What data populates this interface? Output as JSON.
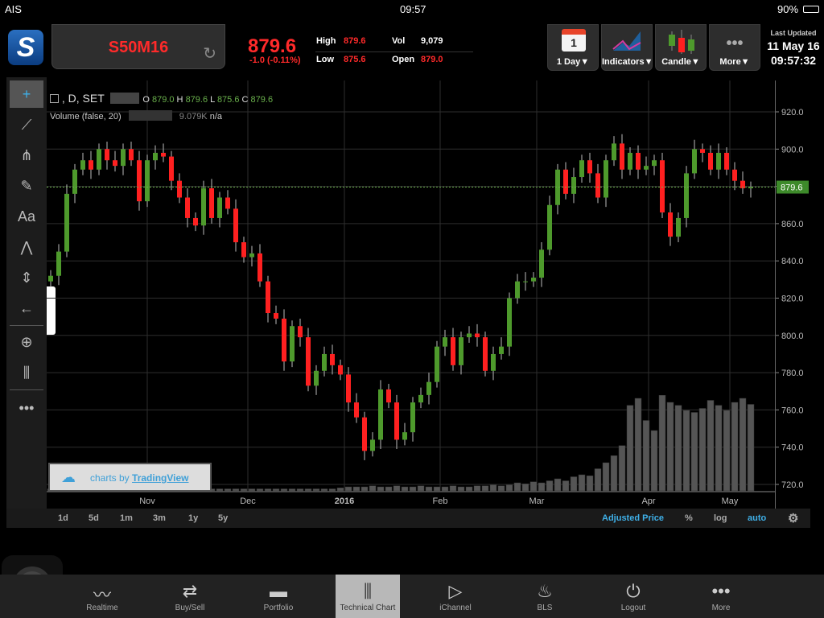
{
  "status": {
    "carrier": "AIS",
    "time": "09:57",
    "battery": "90%"
  },
  "header": {
    "symbol": "S50M16",
    "last": "879.6",
    "change": "-1.0 (-0.11%)",
    "high_label": "High",
    "high": "879.6",
    "low_label": "Low",
    "low": "875.6",
    "vol_label": "Vol",
    "vol": "9,079",
    "open_label": "Open",
    "open": "879.0"
  },
  "toolbar": {
    "period_day": "1",
    "period": "1 Day▼",
    "indicators": "Indicators▼",
    "candle": "Candle▼",
    "more": "More▼",
    "updated_label": "Last Updated",
    "updated_date": "11 May 16",
    "updated_time": "09:57:32"
  },
  "legend": {
    "title": ", D, SET",
    "o_label": "O",
    "o": "879.0",
    "h_label": "H",
    "h": "879.6",
    "l_label": "L",
    "l": "875.6",
    "c_label": "C",
    "c": "879.6",
    "volume": "Volume (false, 20)",
    "volume_val": "9.079K",
    "volume_na": "n/a"
  },
  "watermark": {
    "prefix": "charts by",
    "brand": "TradingView"
  },
  "ranges": [
    "1d",
    "5d",
    "1m",
    "3m",
    "1y",
    "5y"
  ],
  "options": {
    "adjusted": "Adjusted Price",
    "pct": "%",
    "log": "log",
    "auto": "auto"
  },
  "tabs": [
    "Realtime",
    "Buy/Sell",
    "Portfolio",
    "Technical Chart",
    "iChannel",
    "BLS",
    "Logout",
    "More"
  ],
  "colors": {
    "up": "#4e9a2c",
    "down": "#ff2020",
    "accent": "#3fb0e8"
  },
  "chart_data": {
    "type": "candlestick",
    "ylim": [
      712,
      928
    ],
    "yticks": [
      "920.0",
      "900.0",
      "880.0",
      "860.0",
      "840.0",
      "820.0",
      "800.0",
      "780.0",
      "760.0",
      "740.0",
      "720.0"
    ],
    "xticks": [
      {
        "label": "Nov",
        "index": 12
      },
      {
        "label": "Dec",
        "index": 24.5
      },
      {
        "label": "2016",
        "index": 36.5
      },
      {
        "label": "Feb",
        "index": 48.4
      },
      {
        "label": "Mar",
        "index": 60.4
      },
      {
        "label": "Apr",
        "index": 74.3
      },
      {
        "label": "May",
        "index": 84.4
      }
    ],
    "last_price": "879.6",
    "close": [
      832,
      845,
      876,
      889,
      894,
      889,
      900,
      894,
      891,
      900,
      894,
      872,
      894,
      898,
      896,
      883,
      874,
      863,
      859,
      879,
      863,
      874,
      868,
      850,
      842,
      844,
      829,
      812,
      809,
      786,
      805,
      799,
      773,
      781,
      790,
      784,
      779,
      764,
      756,
      738,
      744,
      771,
      764,
      744,
      748,
      764,
      768,
      775,
      794,
      799,
      784,
      799,
      801,
      799,
      781,
      790,
      794,
      820,
      829,
      829,
      831,
      846,
      870,
      889,
      876,
      885,
      894,
      887,
      874,
      894,
      903,
      889,
      898,
      889,
      891,
      894,
      866,
      853,
      863,
      887,
      900,
      898,
      889,
      898,
      889,
      883,
      879,
      879.6
    ],
    "volume": [
      2,
      2,
      2,
      2,
      2,
      2,
      2,
      2,
      2,
      2,
      2,
      2,
      2,
      2,
      2,
      2,
      2,
      2,
      2,
      2,
      2,
      2,
      2,
      2,
      2,
      2,
      2,
      2,
      2,
      2,
      2,
      2,
      2,
      2,
      2,
      2,
      3,
      4,
      4,
      4,
      5,
      4,
      4,
      5,
      4,
      4,
      5,
      4,
      4,
      4,
      5,
      4,
      4,
      5,
      5,
      6,
      5,
      6,
      8,
      7,
      9,
      8,
      10,
      12,
      10,
      14,
      16,
      15,
      22,
      28,
      35,
      45,
      85,
      92,
      70,
      60,
      95,
      88,
      85,
      80,
      78,
      82,
      90,
      85,
      80,
      88,
      92,
      86
    ]
  }
}
